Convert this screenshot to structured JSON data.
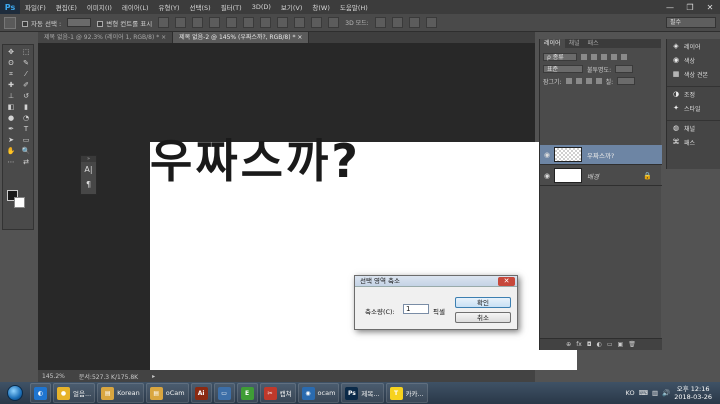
{
  "app": {
    "logo": "Ps",
    "menus": [
      "파일(F)",
      "편집(E)",
      "이미지(I)",
      "레이어(L)",
      "유형(Y)",
      "선택(S)",
      "필터(T)",
      "3D(D)",
      "보기(V)",
      "창(W)",
      "도움말(H)"
    ]
  },
  "window_controls": {
    "minimize": "—",
    "maximize": "❐",
    "close": "✕"
  },
  "options_bar": {
    "auto_select": "자동 선택 :",
    "transform_controls": "변형 컨트롤 표시",
    "mode_3d": "3D 모드:",
    "workspace": "필수"
  },
  "doc_tabs": [
    {
      "label": "제목 없음-1 @ 92.3% (레이어 1, RGB/8) *",
      "close": "×",
      "active": false
    },
    {
      "label": "제목 없음-2 @ 145% (우짜스까?, RGB/8) *",
      "close": "×",
      "active": true
    }
  ],
  "canvas": {
    "text": "우짜스까?"
  },
  "mini_panel": {
    "header": "»",
    "btn1": "A|",
    "btn2": "¶"
  },
  "status_bar": {
    "zoom": "145.2%",
    "doc_info": "문서:527.3 K/175.8K",
    "arrow": "▸"
  },
  "layers_panel": {
    "tabs": [
      "레이어",
      "채널",
      "패스"
    ],
    "kind_label": "ρ 종류",
    "blend_mode": "표준",
    "opacity_label": "불투명도:",
    "lock_label": "잠그기:",
    "fill_label": "칠:",
    "layers": [
      {
        "name": "우짜스까?",
        "thumb": "text",
        "selected": true
      },
      {
        "name": "배경",
        "thumb": "white",
        "selected": false
      }
    ],
    "lock_icon": "🔒",
    "footer_icons": [
      "⊕",
      "fx",
      "◘",
      "◐",
      "▭",
      "▣",
      "🗑"
    ]
  },
  "right_dock": {
    "items": [
      {
        "icon": "◈",
        "label": "레이어"
      },
      {
        "icon": "◉",
        "label": "색상"
      },
      {
        "icon": "▦",
        "label": "색상 견본"
      },
      {
        "icon": "◑",
        "label": "조정"
      },
      {
        "icon": "✦",
        "label": "스타일"
      },
      {
        "icon": "◍",
        "label": "채널"
      },
      {
        "icon": "⌘",
        "label": "패스"
      }
    ]
  },
  "dialog": {
    "title": "선택 영역 축소",
    "close": "✕",
    "field_label": "축소량(C):",
    "field_value": "1",
    "unit": "픽셀",
    "ok": "확인",
    "cancel": "취소"
  },
  "taskbar": {
    "tasks": [
      {
        "label": "",
        "color": "#1f75d0",
        "glyph": "◐"
      },
      {
        "label": "얼음...",
        "color": "#e7b32a",
        "glyph": "●"
      },
      {
        "label": "Korean",
        "color": "#d9a640",
        "glyph": "▤"
      },
      {
        "label": "oCam",
        "color": "#d9a640",
        "glyph": "▤"
      },
      {
        "label": "",
        "color": "#8b2a12",
        "glyph": "Ai"
      },
      {
        "label": "",
        "color": "#3d6fa8",
        "glyph": "▭"
      },
      {
        "label": "",
        "color": "#3f9d36",
        "glyph": "E"
      },
      {
        "label": "캡쳐 ",
        "color": "#c0392b",
        "glyph": "✂"
      },
      {
        "label": "ocam",
        "color": "#2a6bb0",
        "glyph": "◉"
      },
      {
        "label": "제목...",
        "color": "#0b2a48",
        "glyph": "Ps"
      },
      {
        "label": "카카...",
        "color": "#f6d21e",
        "glyph": "T"
      }
    ],
    "ime": "KO",
    "time": "오후 12:16",
    "date": "2018-03-26"
  },
  "colors": {
    "accent_layer_selected": "#6d85a4",
    "canvas_bg": "#ffffff",
    "workspace_bg": "#282828"
  }
}
